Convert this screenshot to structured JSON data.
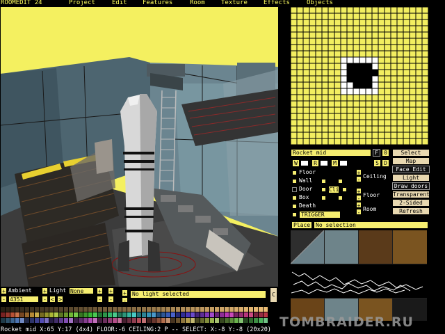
{
  "app": {
    "title": "ROOMEDIT 24"
  },
  "menu": [
    "Project",
    "Edit",
    "Features",
    "Room",
    "Texture",
    "Effects",
    "Objects"
  ],
  "room_panel": {
    "room_name": "Rocket mid",
    "flag_f": "F",
    "flag_0": "0",
    "w": "W",
    "r": "R",
    "m": "M",
    "s": "S",
    "d": "D",
    "types": [
      "Floor",
      "Wall",
      "Door",
      "Box",
      "Death"
    ],
    "cli": "Cli",
    "trigger": "TRIGGER",
    "ceiling_label": "Ceiling",
    "floor_label": "Floor",
    "room_label": "Room",
    "buttons": {
      "select": "Select",
      "map": "Map",
      "face_edit": "Face Edit",
      "light": "Light",
      "draw_doors": "Draw doors",
      "transparent": "Transparent",
      "two_sided": "2-Sided",
      "refresh": "Refresh"
    },
    "place": "Place",
    "selection": "No selection"
  },
  "bottom": {
    "ambient_label": "Ambient",
    "ambient_value": "4351",
    "light_label": "Light",
    "light_type": "None",
    "light_status": "No light selected",
    "c": "C",
    "nav_left": "<",
    "nav_right": ">"
  },
  "status": "Rocket mid X:65 Y:17 (4x4) FLOOR:-6 CEILING:2 P -- SELECT: X:-8 Y:-8 (20x20)",
  "watermark": "TOMBRAIDER.RU",
  "colors": {
    "panel_yellow": "#f6ee70",
    "viewport_yellow": "#f4f060",
    "accent_beige": "#e8d8b0"
  }
}
